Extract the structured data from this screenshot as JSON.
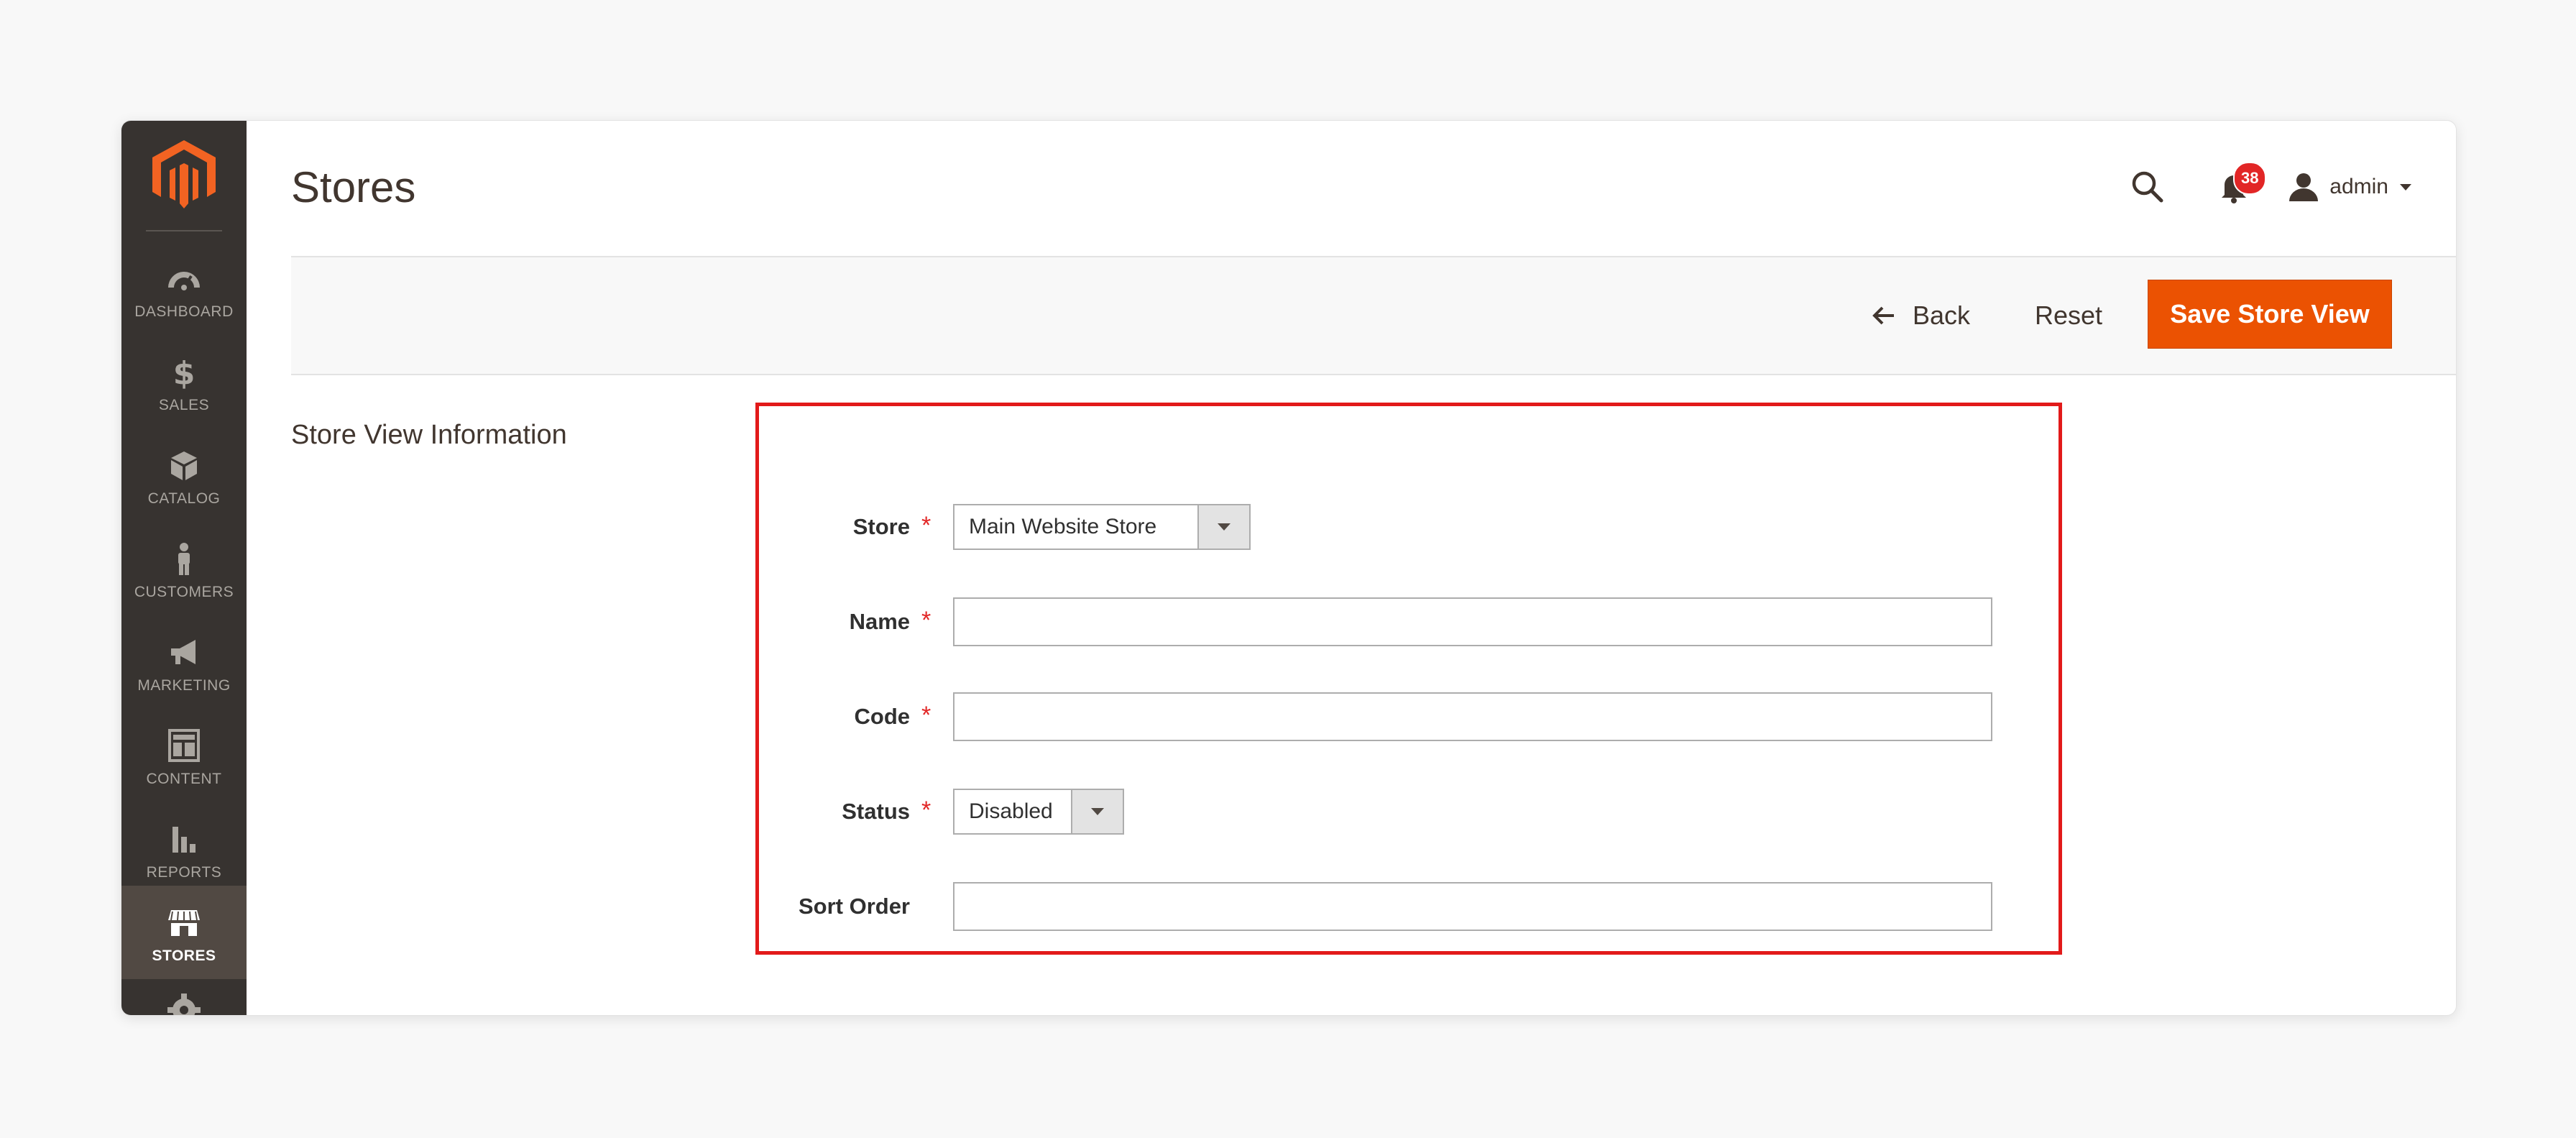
{
  "sidebar": {
    "items": [
      {
        "key": "dashboard",
        "label": "DASHBOARD",
        "icon": "dashboard-icon"
      },
      {
        "key": "sales",
        "label": "SALES",
        "icon": "dollar-icon"
      },
      {
        "key": "catalog",
        "label": "CATALOG",
        "icon": "box-icon"
      },
      {
        "key": "customers",
        "label": "CUSTOMERS",
        "icon": "person-icon"
      },
      {
        "key": "marketing",
        "label": "MARKETING",
        "icon": "megaphone-icon"
      },
      {
        "key": "content",
        "label": "CONTENT",
        "icon": "layout-icon"
      },
      {
        "key": "reports",
        "label": "REPORTS",
        "icon": "bar-chart-icon"
      },
      {
        "key": "stores",
        "label": "STORES",
        "icon": "storefront-icon",
        "active": true
      }
    ]
  },
  "header": {
    "title": "Stores",
    "notifications_count": "38",
    "user_name": "admin"
  },
  "actions": {
    "back_label": "Back",
    "reset_label": "Reset",
    "save_label": "Save Store View"
  },
  "section": {
    "title": "Store View Information"
  },
  "form": {
    "store": {
      "label": "Store",
      "required": true,
      "value": "Main Website Store"
    },
    "name": {
      "label": "Name",
      "required": true,
      "value": ""
    },
    "code": {
      "label": "Code",
      "required": true,
      "value": ""
    },
    "status": {
      "label": "Status",
      "required": true,
      "value": "Disabled"
    },
    "sort_order": {
      "label": "Sort Order",
      "required": false,
      "value": ""
    }
  },
  "colors": {
    "sidebar_bg": "#373330",
    "sidebar_active": "#514943",
    "accent_orange": "#eb5202",
    "highlight_red": "#e21a1a",
    "required_star": "#e22626"
  }
}
